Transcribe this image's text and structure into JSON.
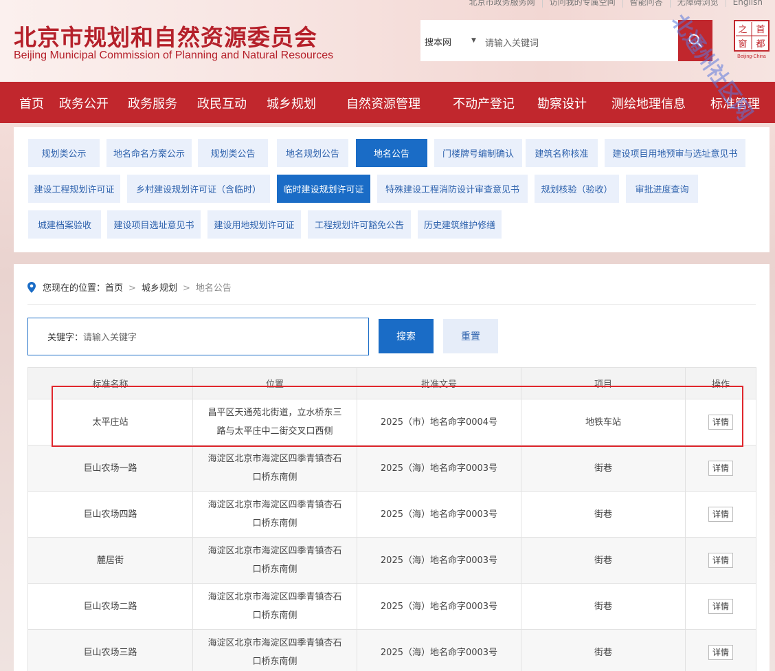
{
  "header": {
    "top_links": [
      "北京市政务服务网",
      "访问我的专属空间",
      "智能问答",
      "无障碍浏览",
      "English"
    ],
    "title": "北京市规划和自然资源委员会",
    "subtitle": "Beijing Municipal Commission of Planning and Natural Resources",
    "search_scope": "搜本网",
    "search_placeholder": "请输入关键词",
    "logo_chars": [
      "首",
      "都",
      "之",
      "窗"
    ],
    "logo_caption": "Beijing-China",
    "watermark": "北通州社区网"
  },
  "nav": [
    "首页",
    "政务公开",
    "政务服务",
    "政民互动",
    "城乡规划",
    "自然资源管理",
    "不动产登记",
    "勘察设计",
    "测绘地理信息",
    "标准管理"
  ],
  "categories": [
    "规划类公示",
    "地名命名方案公示",
    "规划类公告",
    "地名规划公告",
    "地名公告",
    "门楼牌号编制确认",
    "建筑名称核准",
    "建设项目用地预审与选址意见书",
    "建设工程规划许可证",
    "乡村建设规划许可证（含临时）",
    "临时建设规划许可证",
    "特殊建设工程消防设计审查意见书",
    "规划核验（验收）",
    "审批进度查询",
    "城建档案验收",
    "建设项目选址意见书",
    "建设用地规划许可证",
    "工程规划许可豁免公告",
    "历史建筑维护修缮"
  ],
  "active_categories": [
    "地名公告",
    "临时建设规划许可证"
  ],
  "breadcrumb": {
    "prefix": "您现在的位置：",
    "home": "首页",
    "section": "城乡规划",
    "current": "地名公告",
    "sep": ">"
  },
  "filter": {
    "keyword_label": "关键字：",
    "keyword_placeholder": "请输入关键字",
    "search_label": "搜索",
    "reset_label": "重置"
  },
  "table": {
    "headers": [
      "标准名称",
      "位置",
      "批准文号",
      "项目",
      "操作"
    ],
    "detail_label": "详情",
    "rows": [
      {
        "name": "太平庄站",
        "location": "昌平区天通苑北街道，立水桥东三路与太平庄中二街交叉口西侧",
        "doc": "2025（市）地名命字0004号",
        "type": "地铁车站"
      },
      {
        "name": "巨山农场一路",
        "location": "海淀区北京市海淀区四季青镇杏石口桥东南侧",
        "doc": "2025（海）地名命字0003号",
        "type": "街巷"
      },
      {
        "name": "巨山农场四路",
        "location": "海淀区北京市海淀区四季青镇杏石口桥东南侧",
        "doc": "2025（海）地名命字0003号",
        "type": "街巷"
      },
      {
        "name": "麓居街",
        "location": "海淀区北京市海淀区四季青镇杏石口桥东南侧",
        "doc": "2025（海）地名命字0003号",
        "type": "街巷"
      },
      {
        "name": "巨山农场二路",
        "location": "海淀区北京市海淀区四季青镇杏石口桥东南侧",
        "doc": "2025（海）地名命字0003号",
        "type": "街巷"
      },
      {
        "name": "巨山农场三路",
        "location": "海淀区北京市海淀区四季青镇杏石口桥东南侧",
        "doc": "2025（海）地名命字0003号",
        "type": "街巷"
      }
    ]
  },
  "colors": {
    "brand_red": "#c1272d",
    "active_blue": "#1a6cc6",
    "highlight_red": "#e0262c"
  }
}
